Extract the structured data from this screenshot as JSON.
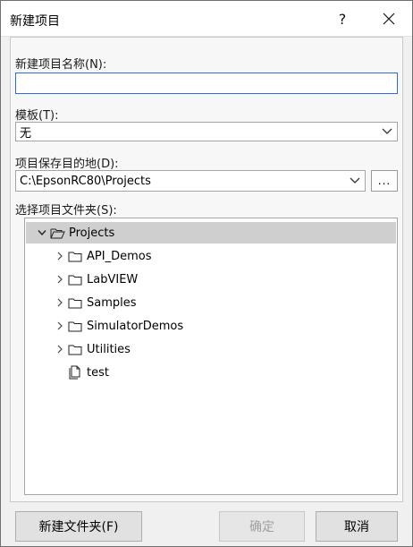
{
  "dialog": {
    "title": "新建项目",
    "help_label": "?",
    "close_icon": "close-icon"
  },
  "form": {
    "name_label": "新建项目名称(N):",
    "name_value": "",
    "template_label": "模板(T):",
    "template_value": "无",
    "location_label": "项目保存目的地(D):",
    "location_value": "C:\\EpsonRC80\\Projects",
    "browse_label": "...",
    "folder_label": "选择项目文件夹(S):"
  },
  "tree": {
    "root": {
      "label": "Projects",
      "expanded": true,
      "selected": true,
      "icon": "folder-open-icon"
    },
    "children": [
      {
        "label": "API_Demos",
        "icon": "folder-icon",
        "expandable": true
      },
      {
        "label": "LabVIEW",
        "icon": "folder-icon",
        "expandable": true
      },
      {
        "label": "Samples",
        "icon": "folder-icon",
        "expandable": true
      },
      {
        "label": "SimulatorDemos",
        "icon": "folder-icon",
        "expandable": true
      },
      {
        "label": "Utilities",
        "icon": "folder-icon",
        "expandable": true
      },
      {
        "label": "test",
        "icon": "project-file-icon",
        "expandable": false
      }
    ]
  },
  "buttons": {
    "new_folder": "新建文件夹(F)",
    "ok": "确定",
    "ok_enabled": false,
    "cancel": "取消"
  },
  "colors": {
    "focus_border": "#2b6fd6",
    "selection": "#cfcfcf",
    "dialog_bg": "#f0f0f0"
  }
}
